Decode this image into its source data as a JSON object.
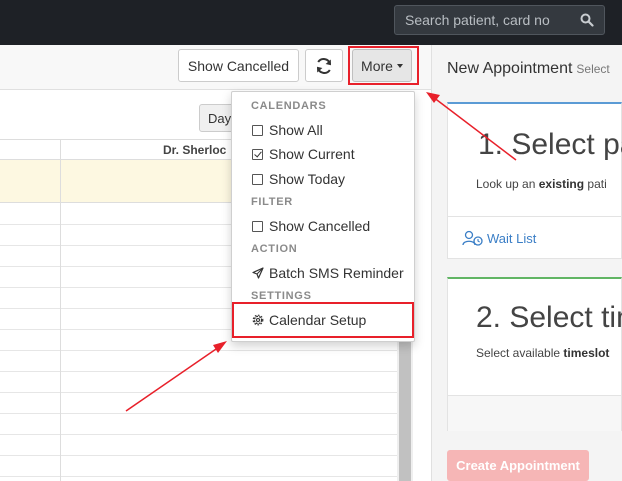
{
  "navbar": {
    "search_placeholder": "Search patient, card no",
    "search_icon": "search-icon"
  },
  "toolbar": {
    "show_cancelled_label": "Show Cancelled",
    "refresh_icon": "refresh-icon",
    "more_label": "More"
  },
  "calendar": {
    "view_button_label": "Day",
    "provider_header": "Dr. Sherloc"
  },
  "menu": {
    "calendars_header": "CALENDARS",
    "show_all": {
      "label": "Show All",
      "checked": false
    },
    "show_current": {
      "label": "Show Current",
      "checked": true
    },
    "show_today": {
      "label": "Show Today",
      "checked": false
    },
    "filter_header": "FILTER",
    "show_cancelled": {
      "label": "Show Cancelled",
      "checked": false
    },
    "action_header": "ACTION",
    "batch_sms": {
      "label": "Batch SMS Reminder",
      "icon": "paper-plane-icon"
    },
    "settings_header": "SETTINGS",
    "calendar_setup": {
      "label": "Calendar Setup",
      "icon": "gear-icon"
    }
  },
  "right_panel": {
    "title": "New Appointment",
    "title_sub": "Select",
    "step1": {
      "heading": "1. Select pa",
      "desc_prefix": "Look up an ",
      "desc_bold": "existing",
      "desc_suffix": " pati"
    },
    "wait_list_label": "Wait List",
    "wait_list_icon": "user-clock-icon",
    "step2": {
      "heading": "2. Select tin",
      "desc_prefix": "Select available ",
      "desc_bold": "timeslot"
    },
    "create_button_label": "Create Appointment"
  },
  "colors": {
    "navbar_bg": "#1e2126",
    "annotation_red": "#e8202a",
    "link_blue": "#3a7ec6",
    "create_button_bg": "#f6b6b6",
    "allday_row_bg": "#fdf8e1"
  }
}
